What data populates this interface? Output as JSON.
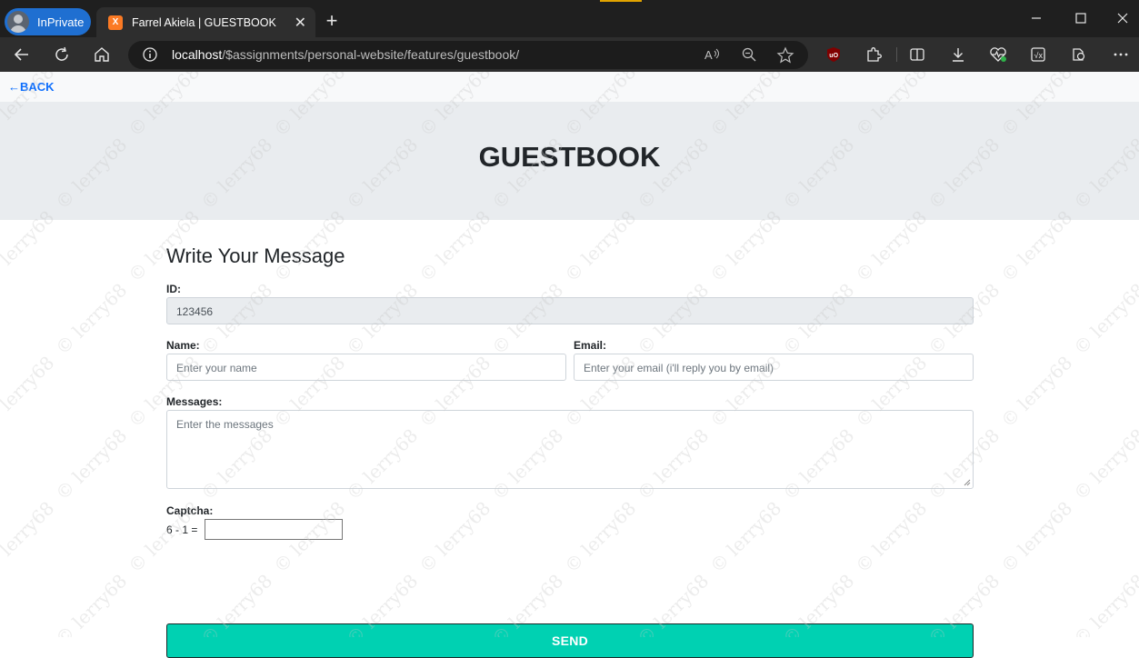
{
  "browser": {
    "inprivate_label": "InPrivate",
    "tab_title": "Farrel Akiela | GUESTBOOK",
    "favicon_text": "X",
    "address_host": "localhost",
    "address_path": "/$assignments/personal-website/features/guestbook/"
  },
  "page": {
    "back_label": "←BACK",
    "hero_title": "GUESTBOOK",
    "form_heading": "Write Your Message",
    "id_label": "ID:",
    "id_value": "123456",
    "name_label": "Name:",
    "name_placeholder": "Enter your name",
    "email_label": "Email:",
    "email_placeholder": "Enter your email (i'll reply you by email)",
    "messages_label": "Messages:",
    "messages_placeholder": "Enter the messages",
    "captcha_label": "Captcha:",
    "captcha_question": "6 - 1 =",
    "send_label": "SEND"
  },
  "watermark": "© lerry68",
  "colors": {
    "accent": "#00d1b2",
    "link": "#0d6efd",
    "hero_bg": "#e9ecef",
    "inprivate_bg": "#1f6fd1"
  }
}
